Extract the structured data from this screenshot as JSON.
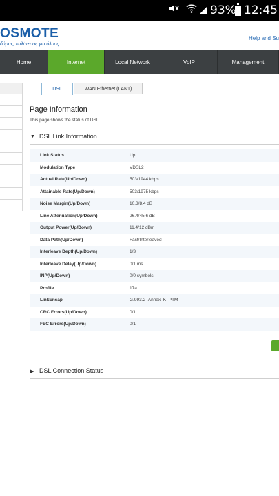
{
  "status_bar": {
    "battery": "93%",
    "time": "12:45"
  },
  "brand": {
    "logo": "OSMOTE",
    "tagline": "δάμας, καλύτερος για όλους.",
    "help_link": "Help and Su"
  },
  "nav": {
    "items": [
      {
        "label": "Home"
      },
      {
        "label": "Internet"
      },
      {
        "label": "Local Network"
      },
      {
        "label": "VoIP"
      },
      {
        "label": "Management"
      }
    ]
  },
  "tabs": [
    {
      "label": "DSL"
    },
    {
      "label": "WAN Ethernet (LAN1)"
    }
  ],
  "page": {
    "title": "Page Information",
    "description": "This page shows the status of DSL."
  },
  "dsl_link": {
    "title": "DSL Link Information",
    "rows": [
      {
        "label": "Link Status",
        "value": "Up"
      },
      {
        "label": "Modulation Type",
        "value": "VDSL2"
      },
      {
        "label": "Actual Rate(Up/Down)",
        "value": "503/1944 kbps"
      },
      {
        "label": "Attainable Rate(Up/Down)",
        "value": "503/1975 kbps"
      },
      {
        "label": "Noise Margin(Up/Down)",
        "value": "10.3/8.4 dB"
      },
      {
        "label": "Line Attenuation(Up/Down)",
        "value": "26.4/45.6 dB"
      },
      {
        "label": "Output Power(Up/Down)",
        "value": "11.4/12 dBm"
      },
      {
        "label": "Data Path(Up/Down)",
        "value": "Fast/Interleaved"
      },
      {
        "label": "Interleave Depth(Up/Down)",
        "value": "1/3"
      },
      {
        "label": "Interleave Delay(Up/Down)",
        "value": "0/1 ms"
      },
      {
        "label": "INP(Up/Down)",
        "value": "0/0 symbols"
      },
      {
        "label": "Profile",
        "value": "17a"
      },
      {
        "label": "LinkEncap",
        "value": "G.993.2_Annex_K_PTM"
      },
      {
        "label": "CRC Errors(Up/Down)",
        "value": "0/1"
      },
      {
        "label": "FEC Errors(Up/Down)",
        "value": "0/1"
      }
    ]
  },
  "dsl_connection": {
    "title": "DSL Connection Status"
  },
  "colors": {
    "brand_blue": "#1a5ea8",
    "active_green": "#5ba82b",
    "nav_dark": "#3c4042"
  }
}
